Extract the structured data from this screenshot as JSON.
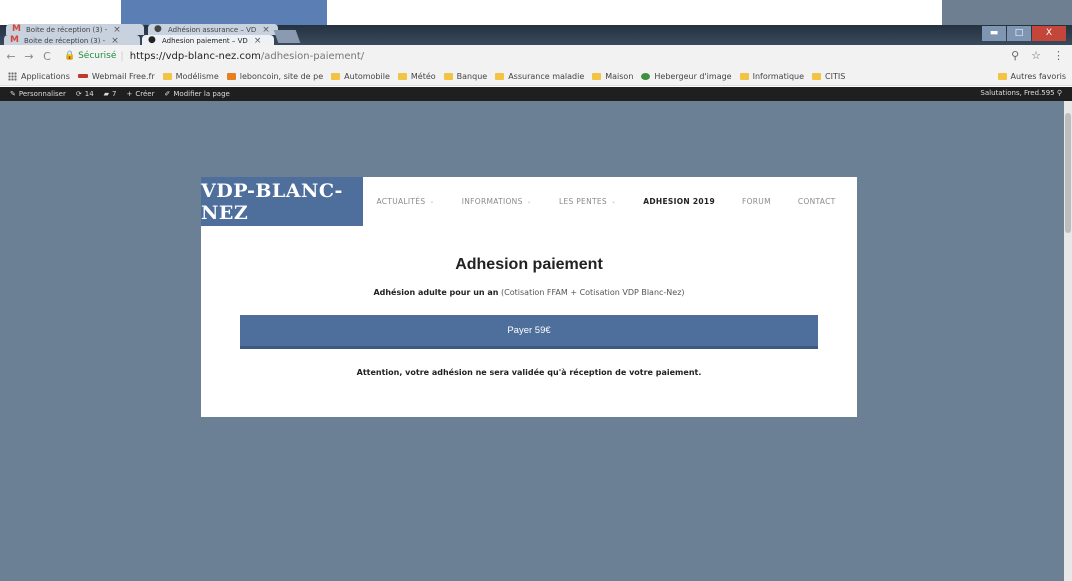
{
  "browser": {
    "tabs": [
      {
        "label": "Boite de réception (3) - ",
        "icon": "gmail-icon"
      },
      {
        "label": "Adhésion assurance – VD",
        "icon": "site-favicon"
      },
      {
        "label": "Boite de réception (3) - ",
        "icon": "gmail-icon"
      },
      {
        "label": "Adhesion paiement – VD",
        "icon": "site-favicon"
      }
    ],
    "close_glyph": "×",
    "nav": {
      "back": "←",
      "forward": "→",
      "reload": "C"
    },
    "secure_label": "Sécurisé",
    "url_host": "https://vdp-blanc-nez.com",
    "url_path": "/adhesion-paiement/",
    "zoom_icon": "⚲",
    "star_icon": "☆",
    "menu_icon": "⋮",
    "window_controls": {
      "min": "▬",
      "max": "□",
      "close": "X"
    }
  },
  "bookmarks": {
    "items": [
      "Applications",
      "Webmail Free.fr",
      "Modélisme",
      "leboncoin, site de pe",
      "Automobile",
      "Météo",
      "Banque",
      "Assurance maladie",
      "Maison",
      "Hebergeur d'image",
      "Informatique",
      "CITIS"
    ],
    "other": "Autres favoris"
  },
  "wp_admin": {
    "customize": "Personnaliser",
    "updates": "14",
    "comments": "7",
    "new": "Créer",
    "edit": "Modifier la page",
    "greeting": "Salutations, Fred.595"
  },
  "site": {
    "logo": "VDP-BLANC-NEZ",
    "nav": [
      "ACTUALITÉS",
      "INFORMATIONS",
      "LES PENTES",
      "ADHESION 2019",
      "FORUM",
      "CONTACT"
    ],
    "page_title": "Adhesion paiement",
    "desc_bold": "Adhésion adulte pour un an",
    "desc_rest": "(Cotisation FFAM + Cotisation VDP Blanc-Nez)",
    "pay_button": "Payer 59€",
    "warning": "Attention, votre adhésion ne sera validée qu'à réception de votre paiement."
  },
  "colors": {
    "brand": "#4e6e9c",
    "background": "#6b7f95",
    "admin_bar": "#1f1f1f"
  }
}
